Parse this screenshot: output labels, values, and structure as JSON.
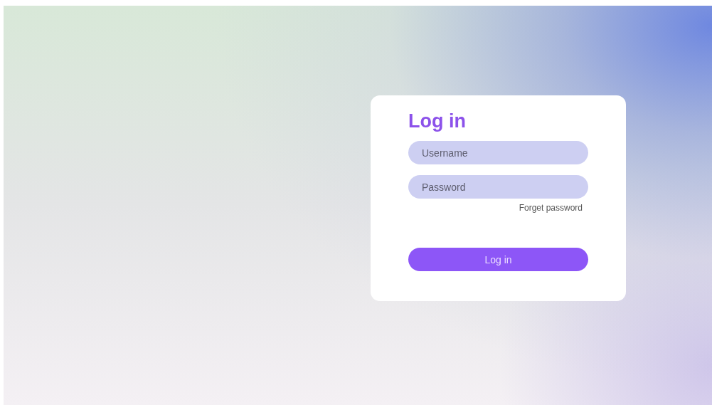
{
  "login_card": {
    "title": "Log in",
    "fields": [
      {
        "placeholder": "Username"
      },
      {
        "placeholder": "Password"
      }
    ],
    "forgot_link": "Forget password",
    "submit_button": "Log in"
  }
}
